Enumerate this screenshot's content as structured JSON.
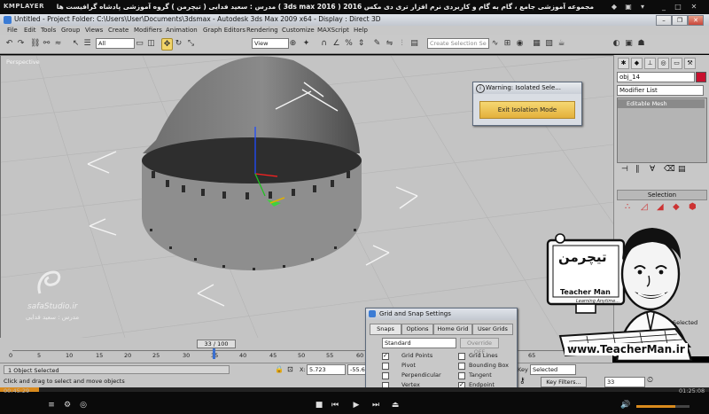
{
  "player": {
    "logo": "KMPLAYER",
    "title": "مجموعه آموزشی جامع ، گام به گام و کاربردی نرم افزار تری دی مکس 2016 ( 3ds max 2016 ) مدرس : سعید فدایی ( تیچرمن ) گروه آموزشی پادشاه گرافیست ها",
    "time_elapsed": "00:45:29",
    "time_total": "01:25:08"
  },
  "window": {
    "title": "Untitled    - Project Folder: C:\\Users\\User\\Documents\\3dsmax    - Autodesk 3ds Max  2009 x64    - Display : Direct 3D"
  },
  "menu": [
    "File",
    "Edit",
    "Tools",
    "Group",
    "Views",
    "Create",
    "Modifiers",
    "Animation",
    "Graph Editors",
    "Rendering",
    "Customize",
    "MAXScript",
    "Help"
  ],
  "toolbar": {
    "filter": "All",
    "reference": "View",
    "selection_set": "Create Selection Se"
  },
  "viewport": {
    "label": "Perspective"
  },
  "watermark": {
    "site": "safaStudio.ir",
    "author": "مدرس : سعید فدایی"
  },
  "command_panel": {
    "object_name": "obj_14",
    "modifier_list": "Modifier List",
    "stack_item": "Editable Mesh",
    "rollout": "Selection",
    "selected_label": "Selected",
    "colors": {
      "object_swatch": "#c8102e"
    }
  },
  "warning_dialog": {
    "title": "Warning: Isolated Sele...",
    "button": "Exit Isolation Mode"
  },
  "grid_dialog": {
    "title": "Grid and Snap Settings",
    "tabs": [
      "Snaps",
      "Options",
      "Home Grid",
      "User Grids"
    ],
    "preset": "Standard",
    "override": "Override OFF",
    "left_options": [
      {
        "label": "Grid Points",
        "checked": true
      },
      {
        "label": "Pivot",
        "checked": false
      },
      {
        "label": "Perpendicular",
        "checked": false
      },
      {
        "label": "Vertex",
        "checked": false
      }
    ],
    "right_options": [
      {
        "label": "Grid Lines",
        "checked": false
      },
      {
        "label": "Bounding Box",
        "checked": false
      },
      {
        "label": "Tangent",
        "checked": false
      },
      {
        "label": "Endpoint",
        "checked": true
      }
    ]
  },
  "timeline": {
    "frame": "33 / 100",
    "ticks": [
      "0",
      "5",
      "10",
      "15",
      "20",
      "25",
      "30",
      "35",
      "40",
      "45",
      "50",
      "55",
      "60",
      "65"
    ]
  },
  "status": {
    "selection": "1 Object Selected",
    "prompt": "Click and drag to select and move objects",
    "x_label": "X:",
    "x_value": "5.723",
    "y_value": "-55.62",
    "key_label": "Key",
    "key_mode": "Selected",
    "key_filters": "Key Filters...",
    "current_frame": "33"
  },
  "overlay": {
    "brand_fa": "تیچرمن",
    "brand_en": "Teacher Man",
    "tagline": "Learning Anytime...",
    "url": "www.TeacherMan.ir"
  }
}
